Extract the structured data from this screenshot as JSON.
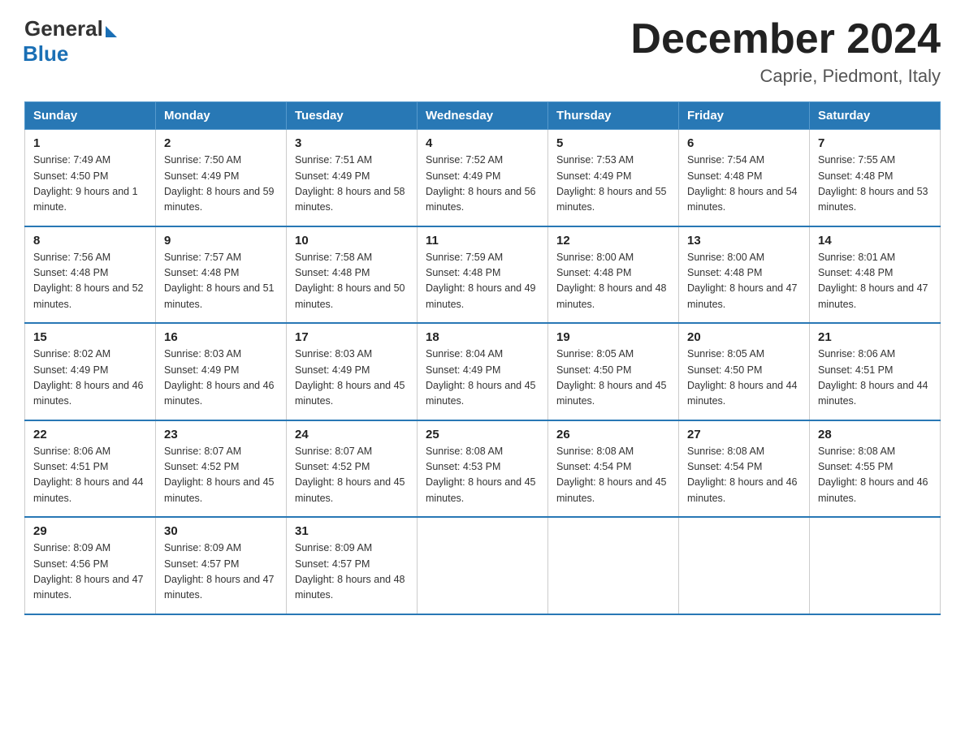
{
  "header": {
    "logo_general": "General",
    "logo_blue": "Blue",
    "month_title": "December 2024",
    "location": "Caprie, Piedmont, Italy"
  },
  "days_of_week": [
    "Sunday",
    "Monday",
    "Tuesday",
    "Wednesday",
    "Thursday",
    "Friday",
    "Saturday"
  ],
  "weeks": [
    [
      {
        "day": "1",
        "sunrise": "7:49 AM",
        "sunset": "4:50 PM",
        "daylight": "9 hours and 1 minute."
      },
      {
        "day": "2",
        "sunrise": "7:50 AM",
        "sunset": "4:49 PM",
        "daylight": "8 hours and 59 minutes."
      },
      {
        "day": "3",
        "sunrise": "7:51 AM",
        "sunset": "4:49 PM",
        "daylight": "8 hours and 58 minutes."
      },
      {
        "day": "4",
        "sunrise": "7:52 AM",
        "sunset": "4:49 PM",
        "daylight": "8 hours and 56 minutes."
      },
      {
        "day": "5",
        "sunrise": "7:53 AM",
        "sunset": "4:49 PM",
        "daylight": "8 hours and 55 minutes."
      },
      {
        "day": "6",
        "sunrise": "7:54 AM",
        "sunset": "4:48 PM",
        "daylight": "8 hours and 54 minutes."
      },
      {
        "day": "7",
        "sunrise": "7:55 AM",
        "sunset": "4:48 PM",
        "daylight": "8 hours and 53 minutes."
      }
    ],
    [
      {
        "day": "8",
        "sunrise": "7:56 AM",
        "sunset": "4:48 PM",
        "daylight": "8 hours and 52 minutes."
      },
      {
        "day": "9",
        "sunrise": "7:57 AM",
        "sunset": "4:48 PM",
        "daylight": "8 hours and 51 minutes."
      },
      {
        "day": "10",
        "sunrise": "7:58 AM",
        "sunset": "4:48 PM",
        "daylight": "8 hours and 50 minutes."
      },
      {
        "day": "11",
        "sunrise": "7:59 AM",
        "sunset": "4:48 PM",
        "daylight": "8 hours and 49 minutes."
      },
      {
        "day": "12",
        "sunrise": "8:00 AM",
        "sunset": "4:48 PM",
        "daylight": "8 hours and 48 minutes."
      },
      {
        "day": "13",
        "sunrise": "8:00 AM",
        "sunset": "4:48 PM",
        "daylight": "8 hours and 47 minutes."
      },
      {
        "day": "14",
        "sunrise": "8:01 AM",
        "sunset": "4:48 PM",
        "daylight": "8 hours and 47 minutes."
      }
    ],
    [
      {
        "day": "15",
        "sunrise": "8:02 AM",
        "sunset": "4:49 PM",
        "daylight": "8 hours and 46 minutes."
      },
      {
        "day": "16",
        "sunrise": "8:03 AM",
        "sunset": "4:49 PM",
        "daylight": "8 hours and 46 minutes."
      },
      {
        "day": "17",
        "sunrise": "8:03 AM",
        "sunset": "4:49 PM",
        "daylight": "8 hours and 45 minutes."
      },
      {
        "day": "18",
        "sunrise": "8:04 AM",
        "sunset": "4:49 PM",
        "daylight": "8 hours and 45 minutes."
      },
      {
        "day": "19",
        "sunrise": "8:05 AM",
        "sunset": "4:50 PM",
        "daylight": "8 hours and 45 minutes."
      },
      {
        "day": "20",
        "sunrise": "8:05 AM",
        "sunset": "4:50 PM",
        "daylight": "8 hours and 44 minutes."
      },
      {
        "day": "21",
        "sunrise": "8:06 AM",
        "sunset": "4:51 PM",
        "daylight": "8 hours and 44 minutes."
      }
    ],
    [
      {
        "day": "22",
        "sunrise": "8:06 AM",
        "sunset": "4:51 PM",
        "daylight": "8 hours and 44 minutes."
      },
      {
        "day": "23",
        "sunrise": "8:07 AM",
        "sunset": "4:52 PM",
        "daylight": "8 hours and 45 minutes."
      },
      {
        "day": "24",
        "sunrise": "8:07 AM",
        "sunset": "4:52 PM",
        "daylight": "8 hours and 45 minutes."
      },
      {
        "day": "25",
        "sunrise": "8:08 AM",
        "sunset": "4:53 PM",
        "daylight": "8 hours and 45 minutes."
      },
      {
        "day": "26",
        "sunrise": "8:08 AM",
        "sunset": "4:54 PM",
        "daylight": "8 hours and 45 minutes."
      },
      {
        "day": "27",
        "sunrise": "8:08 AM",
        "sunset": "4:54 PM",
        "daylight": "8 hours and 46 minutes."
      },
      {
        "day": "28",
        "sunrise": "8:08 AM",
        "sunset": "4:55 PM",
        "daylight": "8 hours and 46 minutes."
      }
    ],
    [
      {
        "day": "29",
        "sunrise": "8:09 AM",
        "sunset": "4:56 PM",
        "daylight": "8 hours and 47 minutes."
      },
      {
        "day": "30",
        "sunrise": "8:09 AM",
        "sunset": "4:57 PM",
        "daylight": "8 hours and 47 minutes."
      },
      {
        "day": "31",
        "sunrise": "8:09 AM",
        "sunset": "4:57 PM",
        "daylight": "8 hours and 48 minutes."
      },
      null,
      null,
      null,
      null
    ]
  ]
}
